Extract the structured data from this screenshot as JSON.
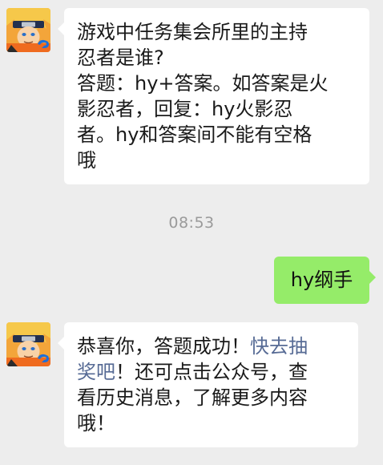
{
  "messages": {
    "first": {
      "lines": [
        "游戏中任务集会所里的主持",
        "忍者是谁?",
        "答题：hy+答案。如答案是火",
        "影忍者，回复：hy火影忍",
        "者。hy和答案间不能有空格",
        "哦"
      ]
    },
    "timestamp": "08:53",
    "reply": "hy纲手",
    "result": {
      "line1_text": "恭喜你，答题成功！",
      "line1_link": "快去抽",
      "line2_link": "奖吧",
      "line2_text": "！还可点击公众号，查",
      "line3": "看历史消息，了解更多内容",
      "line4": "哦！"
    }
  },
  "avatar": {
    "icon": "naruto-avatar-icon",
    "badge_icon": "tencent-games-badge-icon"
  },
  "colors": {
    "background": "#ededed",
    "bubble_left": "#ffffff",
    "bubble_right": "#95ec69",
    "link": "#576b95",
    "timestamp": "#9a9a9a"
  }
}
